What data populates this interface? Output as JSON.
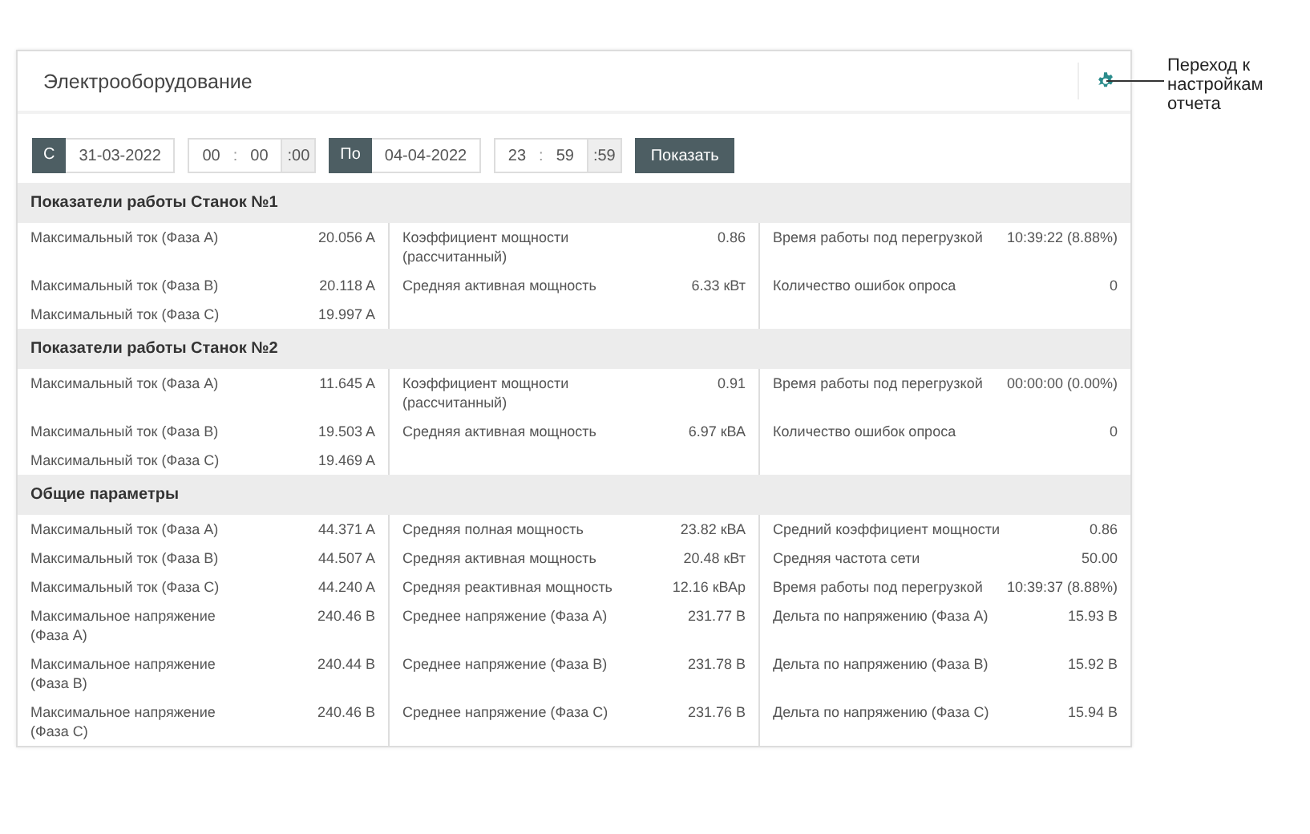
{
  "panel": {
    "title": "Электрооборудование"
  },
  "callout": {
    "text": "Переход к настройкам отчета"
  },
  "filter": {
    "from": {
      "label": "С",
      "date": "31-03-2022",
      "hours": "00",
      "separator": ":",
      "minutes": "00",
      "seconds": ":00"
    },
    "to": {
      "label": "По",
      "date": "04-04-2022",
      "hours": "23",
      "separator": ":",
      "minutes": "59",
      "seconds": ":59"
    },
    "show_button": "Показать"
  },
  "sections": [
    {
      "title": "Показатели работы Станок №1",
      "rows": [
        {
          "cells": [
            {
              "label": "Максимальный ток (Фаза A)",
              "value": "20.056 A"
            },
            {
              "label": "Коэффициент мощности (рассчитанный)",
              "value": "0.86"
            },
            {
              "label": "Время работы под перегрузкой",
              "value": "10:39:22 (8.88%)"
            }
          ]
        },
        {
          "cells": [
            {
              "label": "Максимальный ток (Фаза B)",
              "value": "20.118 A"
            },
            {
              "label": "Средняя активная мощность",
              "value": "6.33 кВт"
            },
            {
              "label": "Количество ошибок опроса",
              "value": "0"
            }
          ]
        },
        {
          "cells": [
            {
              "label": "Максимальный ток (Фаза C)",
              "value": "19.997 A"
            }
          ]
        }
      ]
    },
    {
      "title": "Показатели работы Станок №2",
      "rows": [
        {
          "cells": [
            {
              "label": "Максимальный ток (Фаза A)",
              "value": "11.645 A"
            },
            {
              "label": "Коэффициент мощности (рассчитанный)",
              "value": "0.91"
            },
            {
              "label": "Время работы под перегрузкой",
              "value": "00:00:00 (0.00%)"
            }
          ]
        },
        {
          "cells": [
            {
              "label": "Максимальный ток (Фаза B)",
              "value": "19.503 A"
            },
            {
              "label": "Средняя активная мощность",
              "value": "6.97 кВА"
            },
            {
              "label": "Количество ошибок опроса",
              "value": "0"
            }
          ]
        },
        {
          "cells": [
            {
              "label": "Максимальный ток (Фаза C)",
              "value": "19.469 A"
            }
          ]
        }
      ]
    },
    {
      "title": "Общие параметры",
      "rows": [
        {
          "cells": [
            {
              "label": "Максимальный ток (Фаза A)",
              "value": "44.371 A"
            },
            {
              "label": "Средняя полная мощность",
              "value": "23.82 кВА"
            },
            {
              "label": "Средний коэффициент мощности",
              "value": "0.86"
            }
          ]
        },
        {
          "cells": [
            {
              "label": "Максимальный ток (Фаза B)",
              "value": "44.507 A"
            },
            {
              "label": "Средняя активная мощность",
              "value": "20.48 кВт"
            },
            {
              "label": "Средняя частота сети",
              "value": "50.00"
            }
          ]
        },
        {
          "cells": [
            {
              "label": "Максимальный ток (Фаза C)",
              "value": "44.240 A"
            },
            {
              "label": "Средняя реактивная мощность",
              "value": "12.16 кВАр"
            },
            {
              "label": "Время работы под перегрузкой",
              "value": "10:39:37 (8.88%)"
            }
          ]
        },
        {
          "cells": [
            {
              "label": "Максимальное напряжение (Фаза A)",
              "value": "240.46 В"
            },
            {
              "label": "Среднее напряжение (Фаза A)",
              "value": "231.77 В"
            },
            {
              "label": "Дельта по напряжению (Фаза A)",
              "value": "15.93 В"
            }
          ]
        },
        {
          "cells": [
            {
              "label": "Максимальное напряжение (Фаза B)",
              "value": "240.44 В"
            },
            {
              "label": "Среднее напряжение (Фаза B)",
              "value": "231.78 В"
            },
            {
              "label": "Дельта по напряжению (Фаза B)",
              "value": "15.92 В"
            }
          ]
        },
        {
          "cells": [
            {
              "label": "Максимальное напряжение (Фаза C)",
              "value": "240.46 В"
            },
            {
              "label": "Среднее напряжение (Фаза C)",
              "value": "231.76 В"
            },
            {
              "label": "Дельта по напряжению (Фаза C)",
              "value": "15.94 В"
            }
          ]
        }
      ]
    }
  ]
}
